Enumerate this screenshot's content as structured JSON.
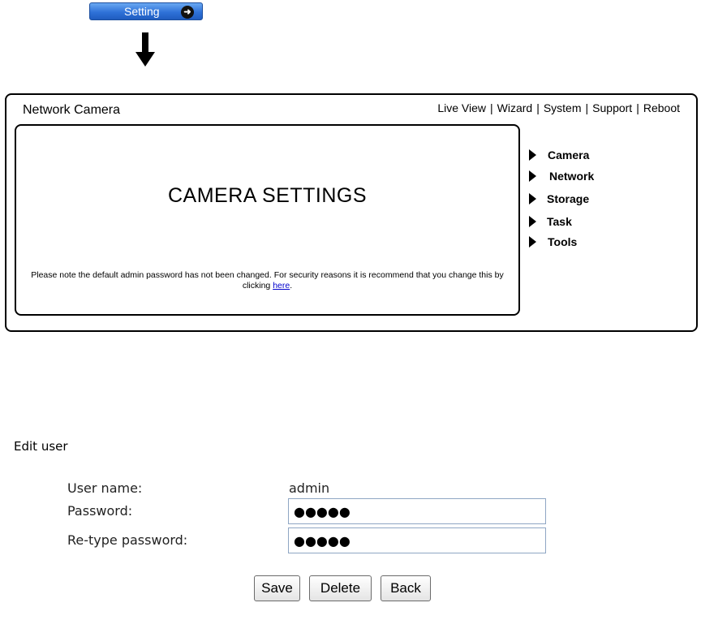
{
  "setting_button": {
    "label": "Setting",
    "arrow_glyph": "➜"
  },
  "camera_ui": {
    "title": "Network Camera",
    "nav": [
      "Live View",
      "Wizard",
      "System",
      "Support",
      "Reboot"
    ],
    "heading": "CAMERA SETTINGS",
    "notice_text": "Please note the default admin password has not been changed. For security reasons it is recommend that you change this by clicking",
    "notice_link": "here",
    "notice_end": ".",
    "side_menu": [
      "Camera",
      "Network",
      "Storage",
      "Task",
      "Tools"
    ]
  },
  "edit_user": {
    "title": "Edit user",
    "username_label": "User name:",
    "username_value": "admin",
    "password_label": "Password:",
    "password_value": "●●●●●",
    "retype_label": "Re-type password:",
    "retype_value": "●●●●●",
    "buttons": {
      "save": "Save",
      "delete": "Delete",
      "back": "Back"
    }
  }
}
